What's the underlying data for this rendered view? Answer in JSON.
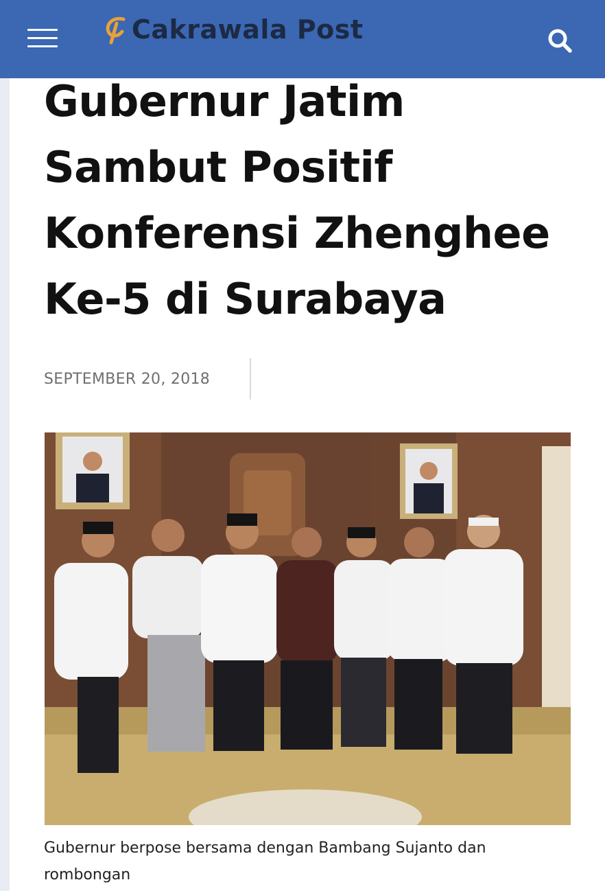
{
  "header": {
    "logo_text": "Cakrawala Post",
    "menu_icon": "hamburger-menu-icon",
    "search_icon": "search-icon",
    "bar_color": "#3b67b3"
  },
  "article": {
    "title": "Gubernur Jatim Sambut Positif Konferensi Zhenghee Ke-5 di Surabaya",
    "date": "SEPTEMBER 20, 2018",
    "image_caption": "Gubernur berpose bersama dengan Bambang Sujanto dan rombongan"
  }
}
